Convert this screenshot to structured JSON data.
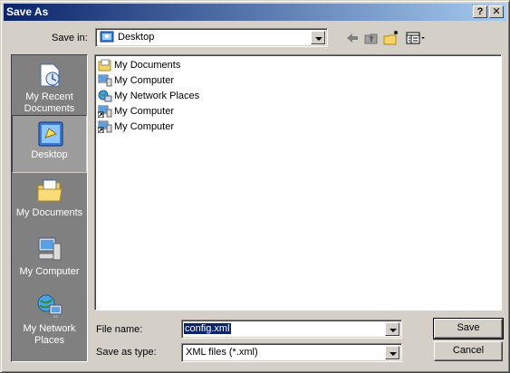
{
  "window": {
    "title": "Save As"
  },
  "titlebar_buttons": {
    "help": "?",
    "close": "✕"
  },
  "save_in": {
    "label": "Save in:",
    "value": "Desktop"
  },
  "toolbar": {
    "icons": [
      "back-icon",
      "up-folder-icon",
      "new-folder-icon",
      "views-menu-icon"
    ]
  },
  "places": [
    {
      "label_line1": "My Recent",
      "label_line2": "Documents",
      "icon": "recent-documents-icon"
    },
    {
      "label_line1": "Desktop",
      "label_line2": "",
      "icon": "desktop-icon"
    },
    {
      "label_line1": "My Documents",
      "label_line2": "",
      "icon": "my-documents-icon"
    },
    {
      "label_line1": "My Computer",
      "label_line2": "",
      "icon": "my-computer-icon"
    },
    {
      "label_line1": "My Network",
      "label_line2": "Places",
      "icon": "network-places-icon"
    }
  ],
  "files": [
    {
      "name": "My Documents",
      "icon": "folder-icon"
    },
    {
      "name": "My Computer",
      "icon": "computer-icon"
    },
    {
      "name": "My Network Places",
      "icon": "network-icon"
    },
    {
      "name": "My Computer",
      "icon": "computer-shortcut-icon"
    },
    {
      "name": "My Computer",
      "icon": "computer-shortcut-icon"
    }
  ],
  "file_name": {
    "label": "File name:",
    "value": "config.xml"
  },
  "save_as_type": {
    "label": "Save as type:",
    "value": "XML files (*.xml)"
  },
  "buttons": {
    "save": "Save",
    "cancel": "Cancel"
  },
  "colors": {
    "title_active": "#0a246a",
    "face": "#d4d0c8",
    "places_bg": "#808080"
  }
}
